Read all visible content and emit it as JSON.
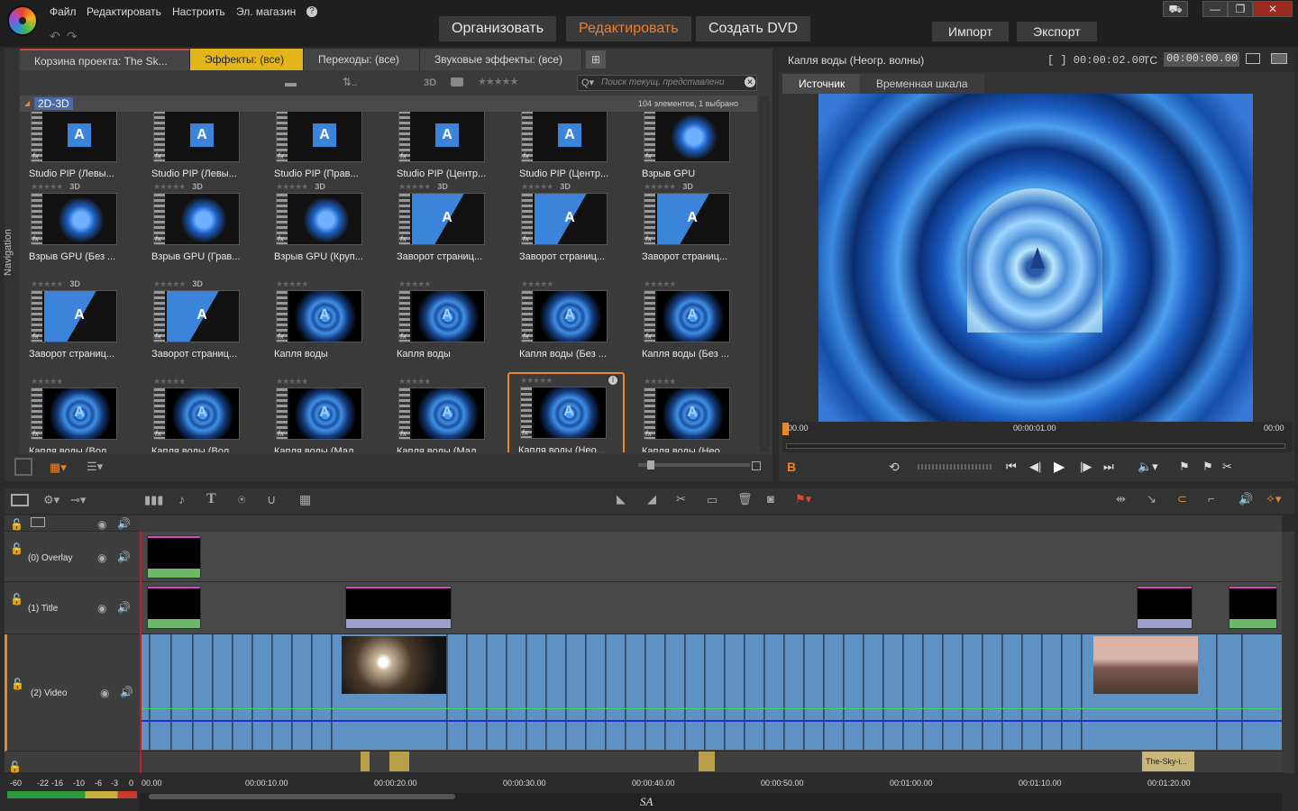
{
  "menu": {
    "file": "Файл",
    "edit": "Редактировать",
    "setup": "Настроить",
    "store": "Эл. магазин",
    "help": "?"
  },
  "modes": {
    "organize": "Организовать",
    "edit": "Редактировать",
    "dvd": "Создать DVD"
  },
  "io": {
    "import": "Импорт",
    "export": "Экспорт"
  },
  "window": {
    "store_icon": "cart-icon",
    "minimize": "—",
    "restore": "❐",
    "close": "✕"
  },
  "library": {
    "tabs": [
      "Корзина проекта: The Sk...",
      "Эффекты: (все)",
      "Переходы: (все)",
      "Звуковые эффекты: (все)"
    ],
    "search_placeholder": "Поиск текущ. представлени",
    "group": "2D-3D",
    "count": "104 элементов, 1 выбрано",
    "tool_3d": "3D",
    "nav_label": "Navigation",
    "items": [
      {
        "cap": "Studio PIP (Левы...",
        "badge": "",
        "kind": "pip"
      },
      {
        "cap": "Studio PIP (Левы...",
        "badge": "",
        "kind": "pip"
      },
      {
        "cap": "Studio PIP (Прав...",
        "badge": "",
        "kind": "pip"
      },
      {
        "cap": "Studio PIP (Центр...",
        "badge": "",
        "kind": "pip"
      },
      {
        "cap": "Studio PIP (Центр...",
        "badge": "",
        "kind": "pip"
      },
      {
        "cap": "Взрыв GPU",
        "badge": "",
        "kind": "shards"
      },
      {
        "cap": "Взрыв GPU (Без ...",
        "badge": "3D",
        "kind": "shards"
      },
      {
        "cap": "Взрыв GPU (Грав...",
        "badge": "3D",
        "kind": "shards"
      },
      {
        "cap": "Взрыв GPU (Круп...",
        "badge": "3D",
        "kind": "shards"
      },
      {
        "cap": "Заворот страниц...",
        "badge": "3D",
        "kind": "page"
      },
      {
        "cap": "Заворот страниц...",
        "badge": "3D",
        "kind": "page"
      },
      {
        "cap": "Заворот страниц...",
        "badge": "3D",
        "kind": "page"
      },
      {
        "cap": "Заворот страниц...",
        "badge": "3D",
        "kind": "page"
      },
      {
        "cap": "Заворот страниц...",
        "badge": "3D",
        "kind": "page"
      },
      {
        "cap": "Капля воды",
        "badge": "",
        "kind": "water"
      },
      {
        "cap": "Капля воды",
        "badge": "",
        "kind": "water"
      },
      {
        "cap": "Капля воды (Без ...",
        "badge": "",
        "kind": "water"
      },
      {
        "cap": "Капля воды (Без ...",
        "badge": "",
        "kind": "water"
      },
      {
        "cap": "Капля воды (Вол...",
        "badge": "",
        "kind": "water"
      },
      {
        "cap": "Капля воды (Вол...",
        "badge": "",
        "kind": "water"
      },
      {
        "cap": "Капля воды (Мал...",
        "badge": "",
        "kind": "water"
      },
      {
        "cap": "Капля воды (Мал...",
        "badge": "",
        "kind": "water"
      },
      {
        "cap": "Капля воды (Нео...",
        "badge": "",
        "kind": "water",
        "selected": true
      },
      {
        "cap": "Капля воды (Нео...",
        "badge": "",
        "kind": "water"
      }
    ]
  },
  "preview": {
    "title": "Капля воды (Неогр. волны)",
    "duration": "[ ] 00:00:02.00",
    "tc_label": "TC",
    "tc": "00:00:00.00",
    "tabs": [
      "Источник",
      "Временная шкала"
    ],
    "ruler": [
      "00.00",
      "00:00:01.00",
      "00:00"
    ],
    "b_label": "B"
  },
  "timeline": {
    "tracks": [
      {
        "name": "(0) Overlay"
      },
      {
        "name": "(1) Title"
      },
      {
        "name": "(2) Video"
      }
    ],
    "ruler": [
      "00.00",
      "00:00:10.00",
      "00:00:20.00",
      "00:00:30.00",
      "00:00:40.00",
      "00:00:50.00",
      "00:01:00.00",
      "00:01:10.00",
      "00:01:20.00"
    ],
    "clip_label": "The-Sky-i...",
    "meter_labels": [
      "-60",
      "-22",
      "-16",
      "-10",
      "-6",
      "-3",
      "0"
    ],
    "footer": "SA"
  }
}
